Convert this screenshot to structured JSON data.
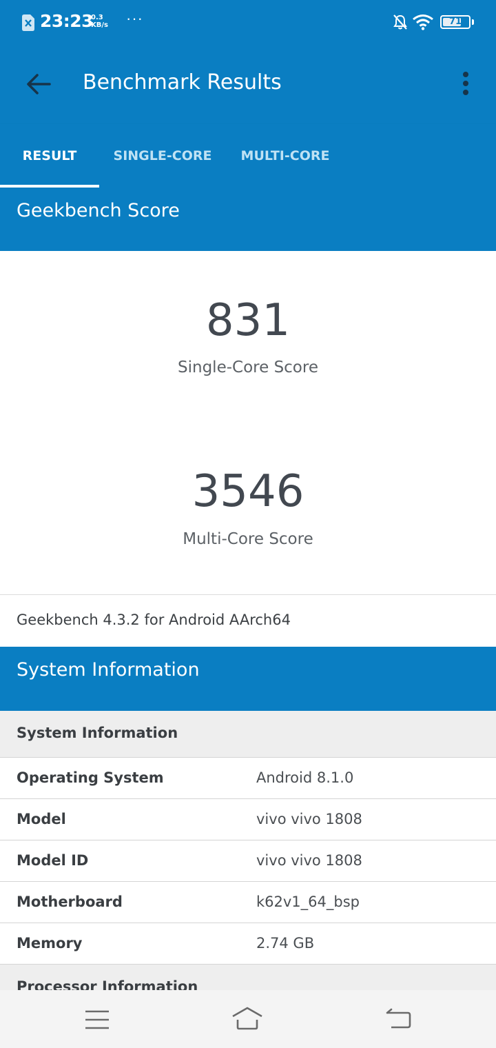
{
  "status_bar": {
    "time": "23:23",
    "net_speed_value": "0.3",
    "net_speed_unit": "KB/s",
    "more": "···",
    "battery": "71",
    "battery_level": 0.71
  },
  "app_bar": {
    "title": "Benchmark Results"
  },
  "tabs": [
    {
      "label": "RESULT",
      "active": true
    },
    {
      "label": "SINGLE-CORE",
      "active": false
    },
    {
      "label": "MULTI-CORE",
      "active": false
    }
  ],
  "score_section": {
    "header": "Geekbench Score",
    "single_core_score": "831",
    "single_core_label": "Single-Core Score",
    "multi_core_score": "3546",
    "multi_core_label": "Multi-Core Score",
    "version": "Geekbench 4.3.2 for Android AArch64"
  },
  "system_section": {
    "header": "System Information",
    "group_title": "System Information",
    "rows": [
      {
        "key": "Operating System",
        "value": "Android 8.1.0"
      },
      {
        "key": "Model",
        "value": "vivo vivo 1808"
      },
      {
        "key": "Model ID",
        "value": "vivo vivo 1808"
      },
      {
        "key": "Motherboard",
        "value": "k62v1_64_bsp"
      },
      {
        "key": "Memory",
        "value": "2.74 GB"
      }
    ],
    "next_group_title": "Processor Information"
  },
  "colors": {
    "primary": "#0a7ec2",
    "tab_inactive": "#bfe2f4",
    "score_text": "#424850",
    "group_header_bg": "#eeeeee"
  },
  "icons": {
    "sim": "sim-card-icon",
    "bell_off": "bell-off-icon",
    "wifi": "wifi-icon",
    "back": "arrow-left-icon",
    "overflow": "more-vert-icon",
    "nav_menu": "menu-icon",
    "nav_home": "home-icon",
    "nav_back": "back-icon"
  }
}
